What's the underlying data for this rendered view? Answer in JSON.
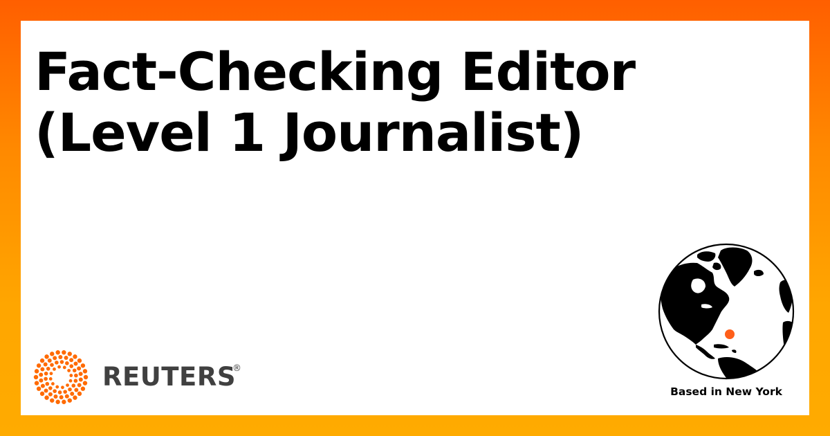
{
  "headline": {
    "line1": "Fact-Checking Editor",
    "line2": "(Level 1 Journalist)"
  },
  "brand": {
    "name": "REUTERS",
    "trademark": "®"
  },
  "location": {
    "label": "Based in New York"
  },
  "colors": {
    "accent": "#ff6a00",
    "gradient_top": "#ff5f00",
    "gradient_bottom": "#ffab00",
    "card": "#ffffff",
    "text": "#000000",
    "wordmark": "#404040",
    "marker": "#ff5f1a"
  },
  "icons": {
    "logo": "reuters-dot-ring-icon",
    "globe": "globe-icon",
    "marker": "location-marker-icon"
  }
}
